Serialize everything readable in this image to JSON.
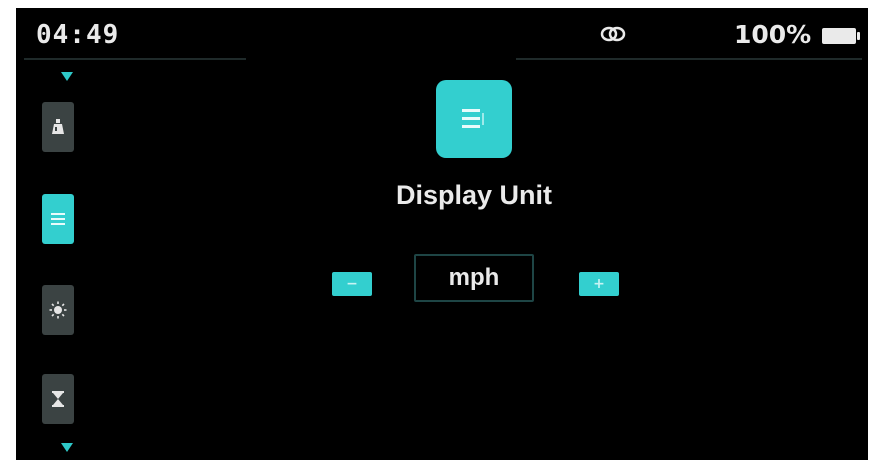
{
  "status_bar": {
    "time": "04:49",
    "battery": "100%",
    "link_icon": "link-icon",
    "battery_icon": "battery-full-icon"
  },
  "sidebar": {
    "items": [
      {
        "icon": "lamp-icon",
        "active": false
      },
      {
        "icon": "list-icon",
        "active": true
      },
      {
        "icon": "brightness-icon",
        "active": false
      },
      {
        "icon": "hourglass-icon",
        "active": false
      }
    ]
  },
  "main": {
    "icon": "list-icon",
    "title": "Display Unit",
    "value": "mph",
    "decrement_label": "−",
    "increment_label": "+"
  },
  "colors": {
    "accent": "#33cfcf",
    "background": "#000000",
    "inactive_item": "#3b4343",
    "text": "#eaeaea"
  }
}
